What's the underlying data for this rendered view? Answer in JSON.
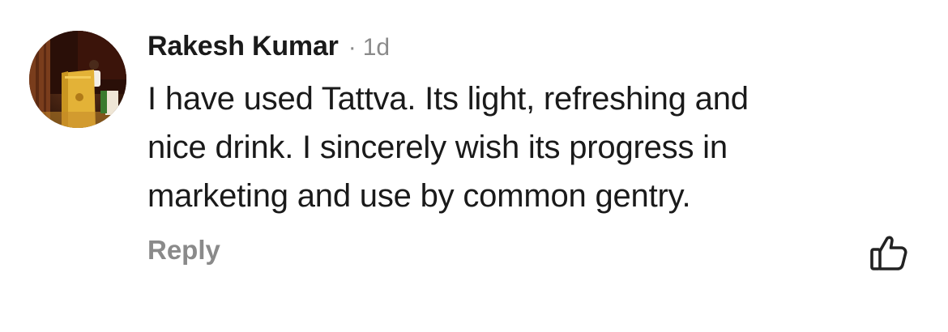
{
  "comment": {
    "author": "Rakesh Kumar",
    "separator": "·",
    "timestamp": "1d",
    "text_lines": [
      "I have used Tattva. Its light, refreshing and",
      "nice drink. I sincerely wish its progress in",
      "marketing and use by common gentry."
    ],
    "reply_label": "Reply",
    "avatar_icon": "user-avatar-photo",
    "like_icon": "thumbs-up-icon"
  },
  "colors": {
    "author_text": "#1a1a1a",
    "muted_text": "#8a8a8a",
    "background": "#ffffff"
  }
}
